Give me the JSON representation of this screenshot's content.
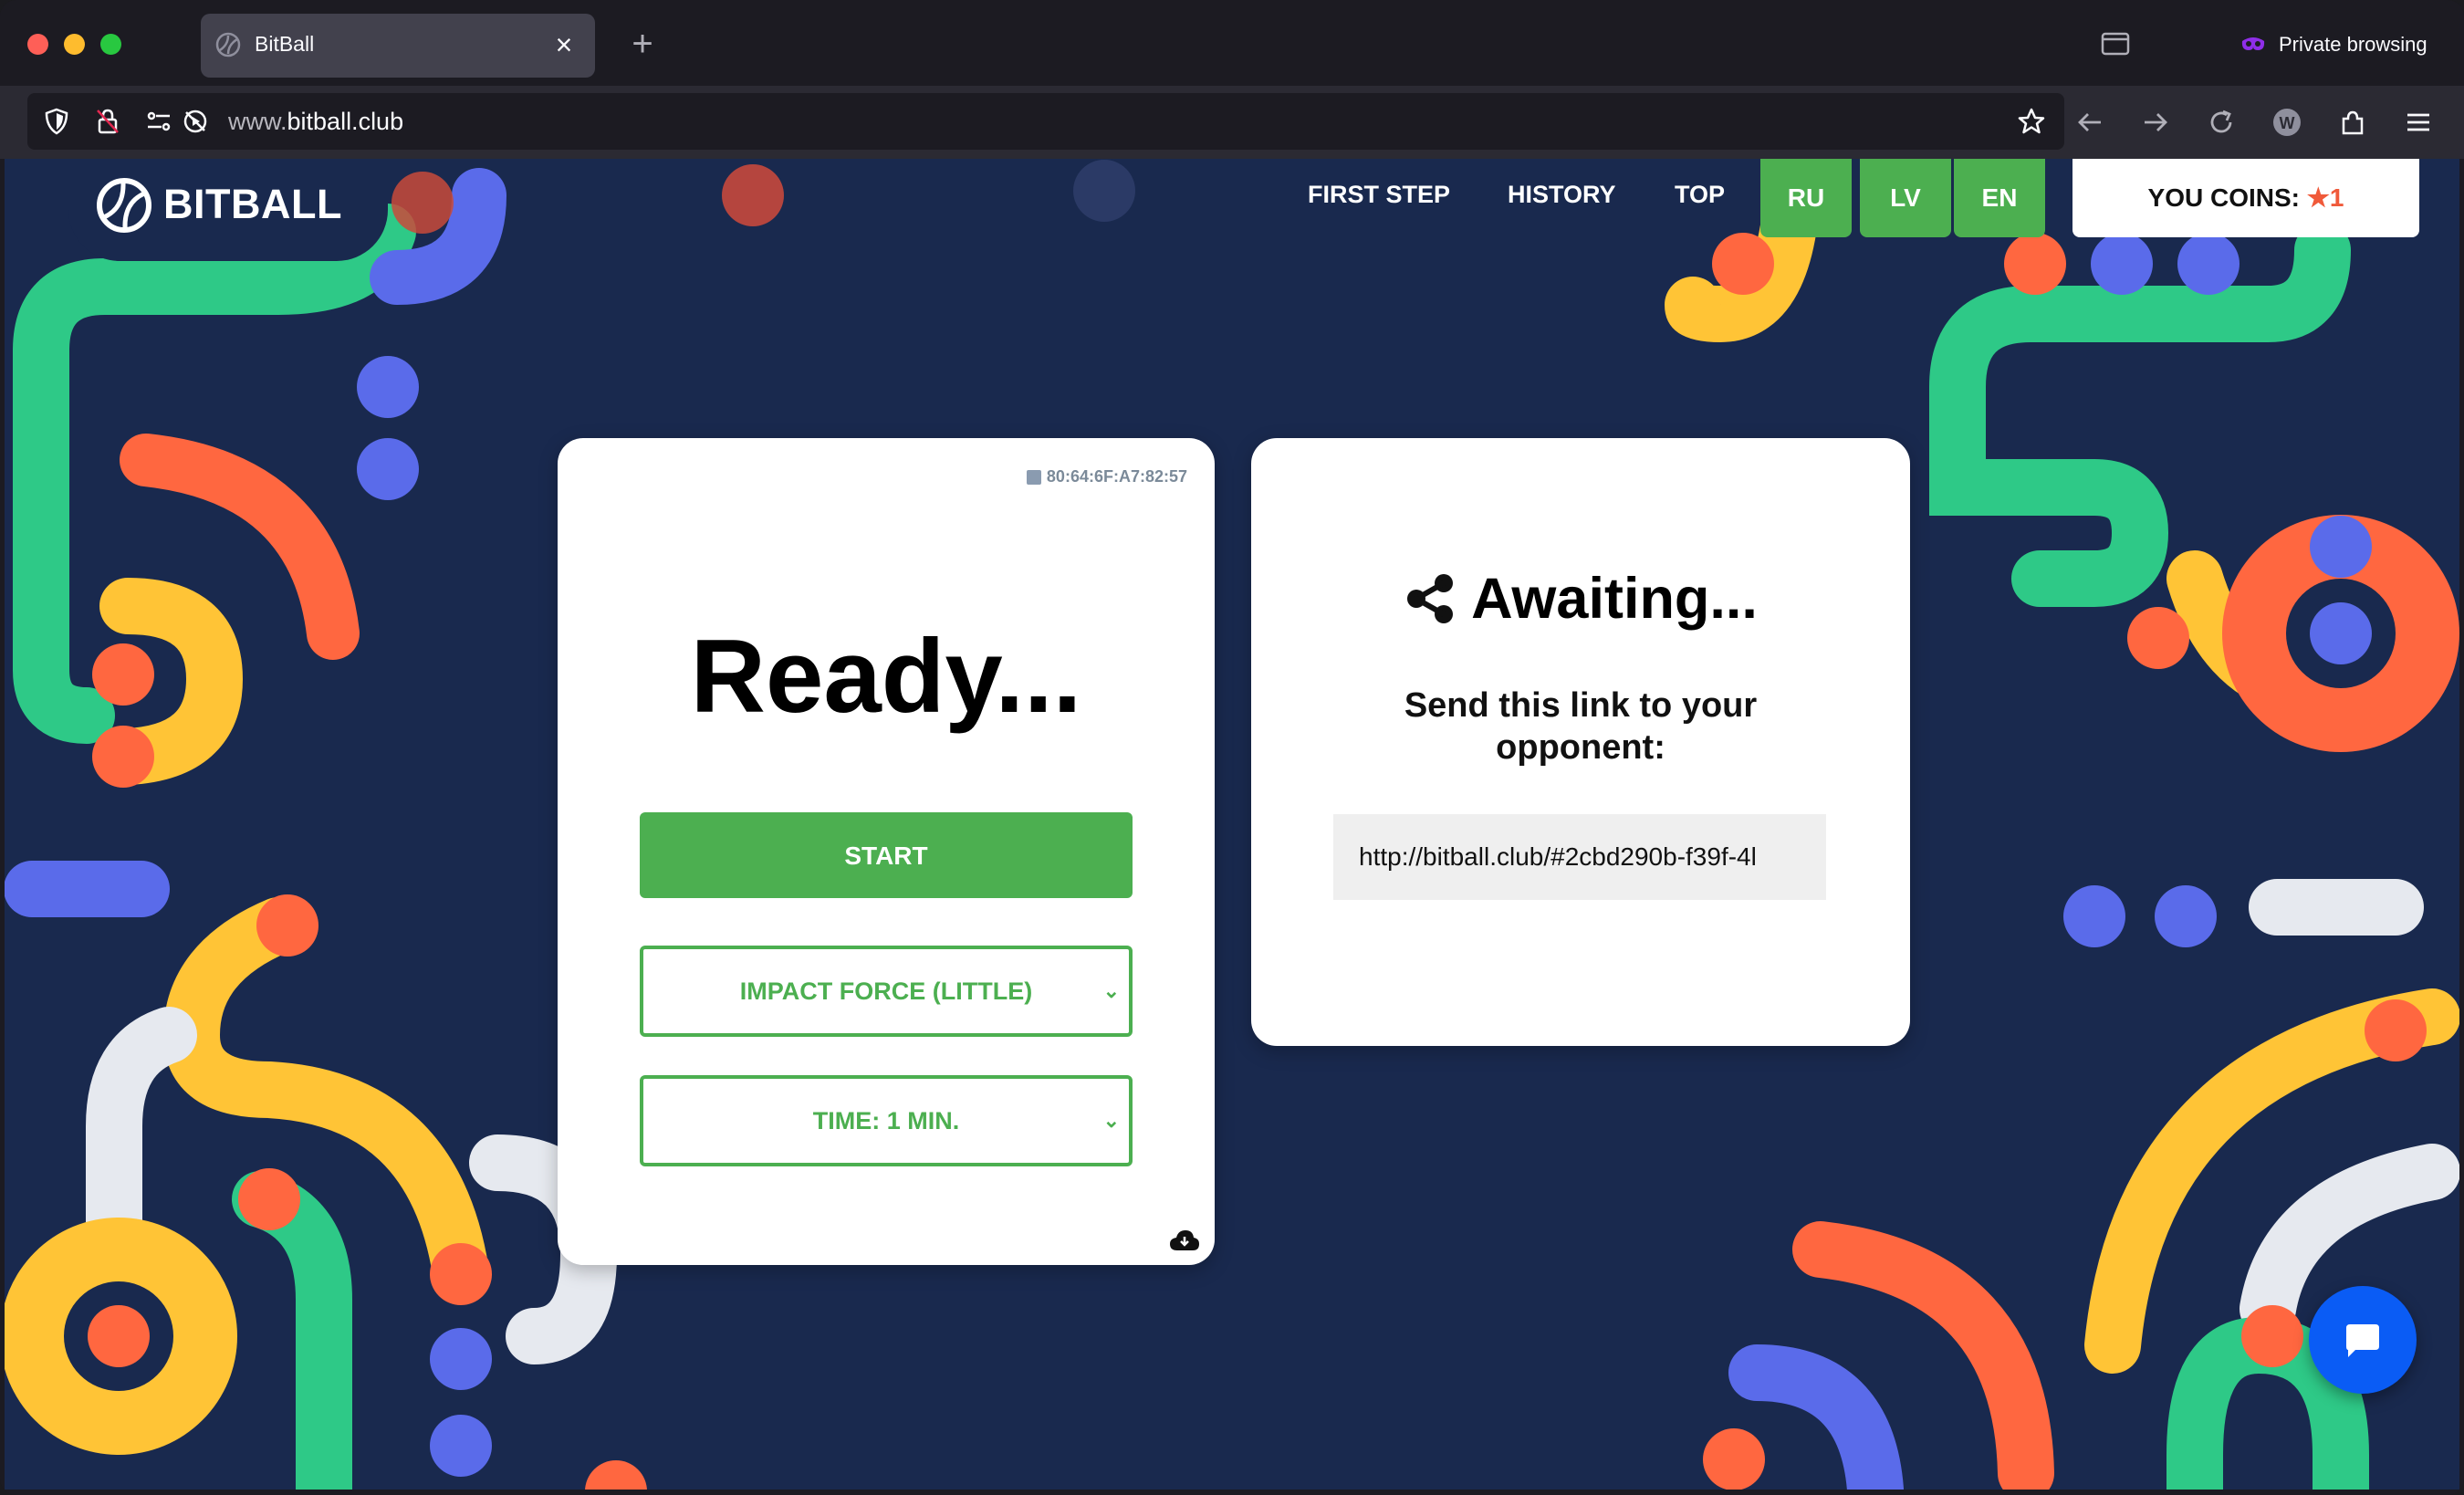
{
  "browser": {
    "tab_title": "BitBall",
    "url_host_prefix": "www.",
    "url_host": "bitball.club",
    "private_label": "Private browsing"
  },
  "site": {
    "logo_text": "BITBALL",
    "menu": [
      "FIRST STEP",
      "HISTORY",
      "TOP"
    ],
    "languages": [
      "RU",
      "LV",
      "EN"
    ],
    "coins_label": "YOU COINS:",
    "coins_value": "1",
    "accent_green": "#4caf50",
    "background": "#19294e"
  },
  "game_card": {
    "device_id": "80:64:6F:A7:82:57",
    "status": "Ready...",
    "start_label": "START",
    "impact_force": "IMPACT FORCE (LITTLE)",
    "time": "TIME: 1 MIN."
  },
  "invite_card": {
    "title": "Awaiting...",
    "instruction": "Send this link to your opponent:",
    "link": "http://bitball.club/#2cbd290b-f39f-4l"
  }
}
